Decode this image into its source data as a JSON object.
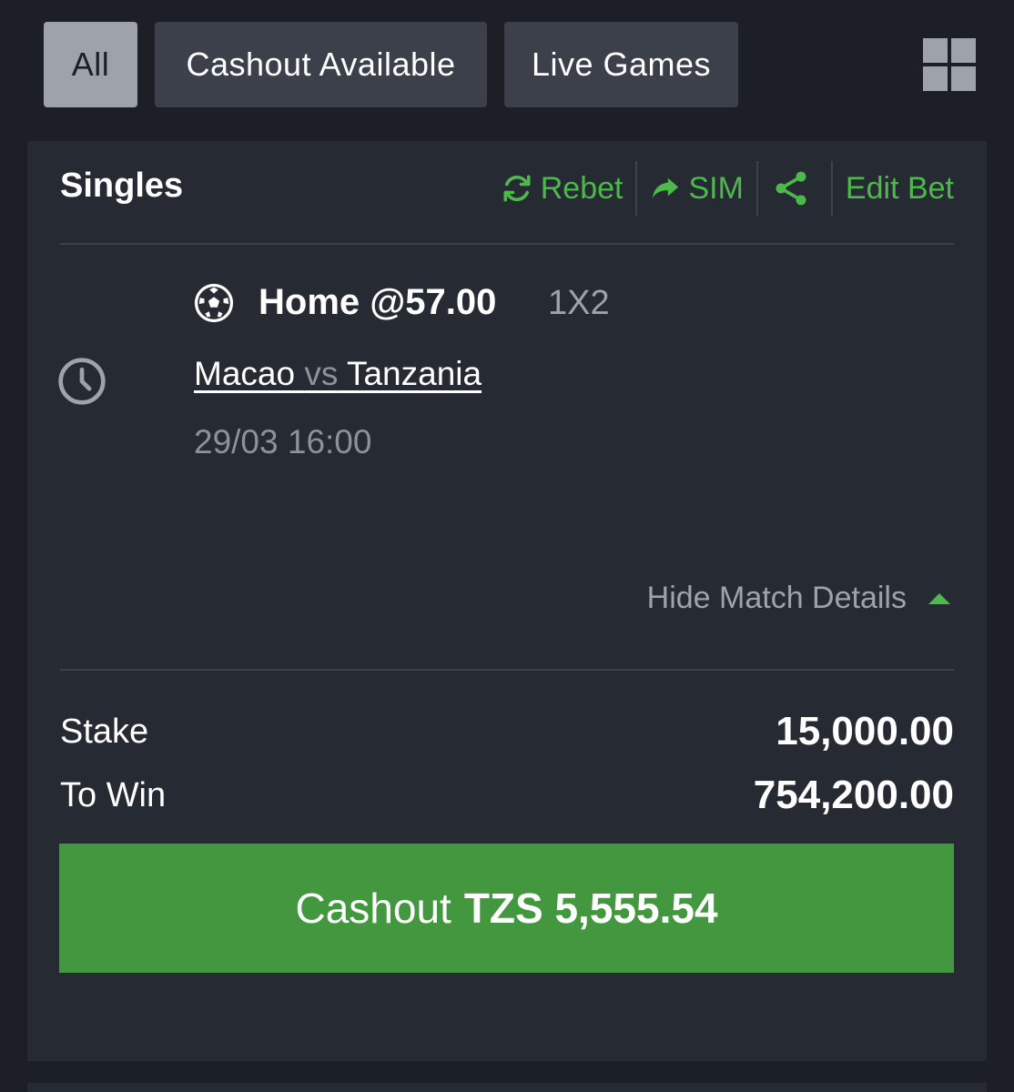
{
  "filters": {
    "all": "All",
    "cashout_available": "Cashout Available",
    "live_games": "Live Games",
    "layout_icon": "grid-icon"
  },
  "bet": {
    "type_title": "Singles",
    "actions": {
      "rebet": "Rebet",
      "sim": "SIM",
      "share_icon": "share-icon",
      "edit_bet": "Edit Bet"
    },
    "selection": {
      "sport_icon": "soccer-ball-icon",
      "pick": "Home @57.00",
      "market": "1X2",
      "home_team": "Macao",
      "vs": "vs",
      "away_team": "Tanzania",
      "datetime": "29/03 16:00",
      "status_icon": "clock-icon"
    },
    "toggle_details": "Hide Match Details",
    "stake_label": "Stake",
    "stake_value": "15,000.00",
    "to_win_label": "To Win",
    "to_win_value": "754,200.00",
    "cashout_label": "Cashout",
    "cashout_amount": "TZS 5,555.54"
  },
  "colors": {
    "background": "#1c1f26",
    "card": "#262a33",
    "accent_green": "#4cb94a",
    "cashout_green": "#43983f",
    "active_filter": "#9ea2ab",
    "inactive_filter": "#3b404b"
  }
}
